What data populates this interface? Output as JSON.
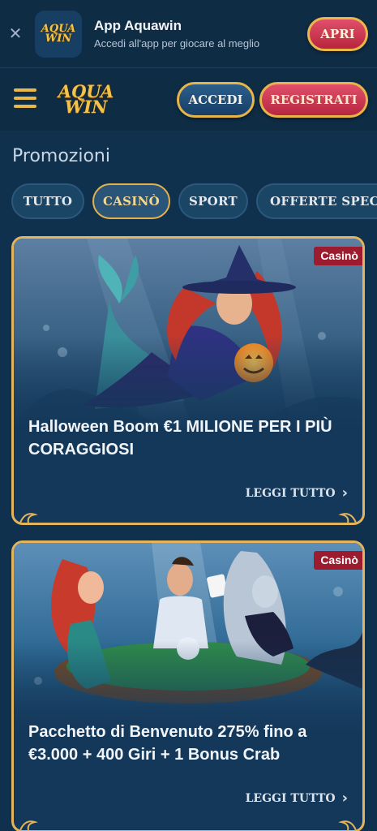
{
  "app_banner": {
    "close_icon": "close-icon",
    "logo_line1": "AQUA",
    "logo_line2": "WIN",
    "app_name": "App Aquawin",
    "subtitle": "Accedi all'app per giocare al meglio",
    "open_label": "APRI"
  },
  "header": {
    "menu_icon": "hamburger-menu-icon",
    "logo_line1": "AQUA",
    "logo_line2": "WIN",
    "login_label": "ACCEDI",
    "register_label": "REGISTRATI"
  },
  "page": {
    "title": "Promozioni"
  },
  "tabs": [
    {
      "label": "TUTTO",
      "active": false
    },
    {
      "label": "CASINÒ",
      "active": true
    },
    {
      "label": "SPORT",
      "active": false
    },
    {
      "label": "OFFERTE SPECIA",
      "active": false
    }
  ],
  "promotions": [
    {
      "badge": "Casinò",
      "title": "Halloween Boom €1 MILIONE PER I PIÙ CORAGGIOSI",
      "read_more": "LEGGI TUTTO"
    },
    {
      "badge": "Casinò",
      "title": "Pacchetto di Benvenuto 275% fino a €3.000 + 400 Giri + 1 Bonus Crab",
      "read_more": "LEGGI TUTTO"
    }
  ],
  "colors": {
    "background": "#10314d",
    "gold": "#e3b45b",
    "red": "#b8243c",
    "badge": "#9d1b2f"
  }
}
